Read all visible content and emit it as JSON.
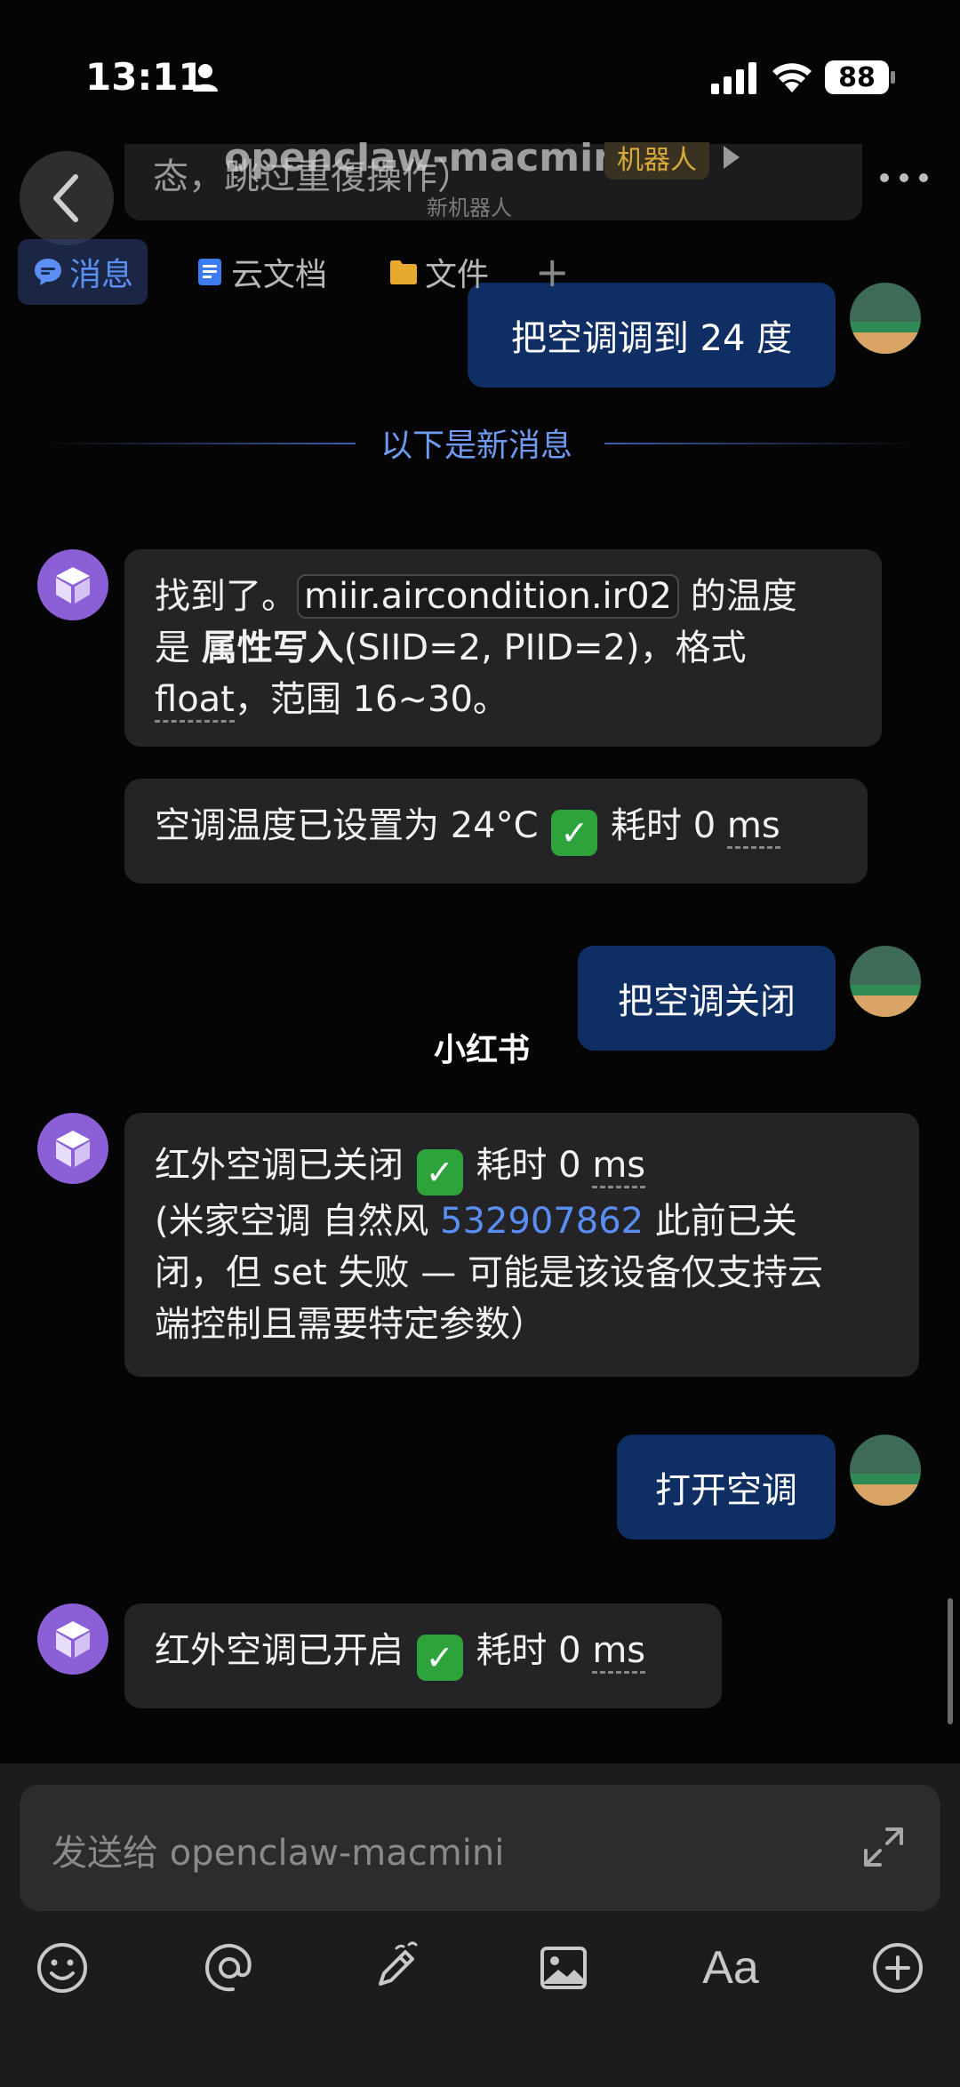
{
  "status_bar": {
    "time": "13:11",
    "battery": "88"
  },
  "header": {
    "pinned_text": "态，跳过重復操作）",
    "title": "openclaw-macmini",
    "badge": "机器人",
    "subtitle": "新机器人",
    "tabs": [
      {
        "label": "消息",
        "icon": "message-icon"
      },
      {
        "label": "云文档",
        "icon": "doc-icon"
      },
      {
        "label": "文件",
        "icon": "folder-icon"
      }
    ],
    "add_tab": "+"
  },
  "messages": {
    "m1": {
      "text": "把空调调到 24 度"
    },
    "divider": "以下是新消息",
    "m2": {
      "p1": "找到了。",
      "code": "miir.aircondition.ir02",
      "p2": " 的温度",
      "p3": "是 ",
      "bold": "属性写入",
      "p4": "(SIID=2, PIID=2)，格式",
      "p5": "float",
      "p6": "，范围 16~30。"
    },
    "m3": {
      "a": "空调温度已设置为 24°C",
      "check": "✓",
      "b": "耗时 0 ",
      "ms": "ms"
    },
    "m4": {
      "text": "把空调关闭"
    },
    "m5": {
      "a": "红外空调已关闭",
      "check": "✓",
      "b": "耗时 0 ",
      "ms": "ms",
      "c": "(米家空调 自然风 ",
      "link": "532907862",
      "d": " 此前已关",
      "e": "闭，但 set 失败 — 可能是该设备仅支持云",
      "f": "端控制且需要特定参数）"
    },
    "m6": {
      "text": "打开空调"
    },
    "m7": {
      "a": "红外空调已开启",
      "check": "✓",
      "b": "耗时 0 ",
      "ms": "ms"
    }
  },
  "watermark": "小红书",
  "composer": {
    "placeholder": "发送给 openclaw-macmini",
    "tools": [
      "emoji-icon",
      "mention-icon",
      "pen-icon",
      "image-icon",
      "font-icon",
      "plus-icon"
    ],
    "font_tool_label": "Aa"
  },
  "colors": {
    "accent": "#5b8ff4",
    "user_bubble": "#0f2e64",
    "bot_bubble": "#242426",
    "bot_avatar": "#8b5fd6",
    "check": "#2fa33b",
    "badge_text": "#d9aa3b"
  }
}
